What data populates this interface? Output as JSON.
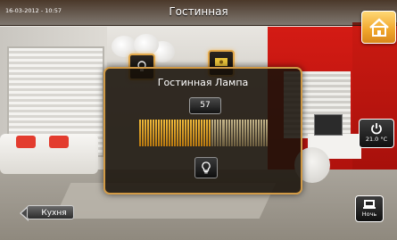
{
  "header": {
    "datetime": "16-03-2012 - 10:57",
    "room_title": "Гостинная"
  },
  "dimmer": {
    "title": "Гостинная Лампа",
    "value": "57",
    "level_fraction": 0.57,
    "active_color_dark": "#b8780f",
    "active_color_light": "#f2bb3a",
    "inactive_color_dark": "#6b5c3e",
    "inactive_color_light": "#c8b88c"
  },
  "climate": {
    "temperature": "21.0 °C"
  },
  "scene": {
    "night_label": "Ночь"
  },
  "navigation": {
    "back_label": "Кухня"
  },
  "colors": {
    "accent": "#d19a46",
    "home_button": "#f0a52b"
  },
  "icons": [
    "home-icon",
    "lamp-icon",
    "display-icon",
    "power-icon",
    "bulb-icon",
    "night-scene-icon"
  ]
}
